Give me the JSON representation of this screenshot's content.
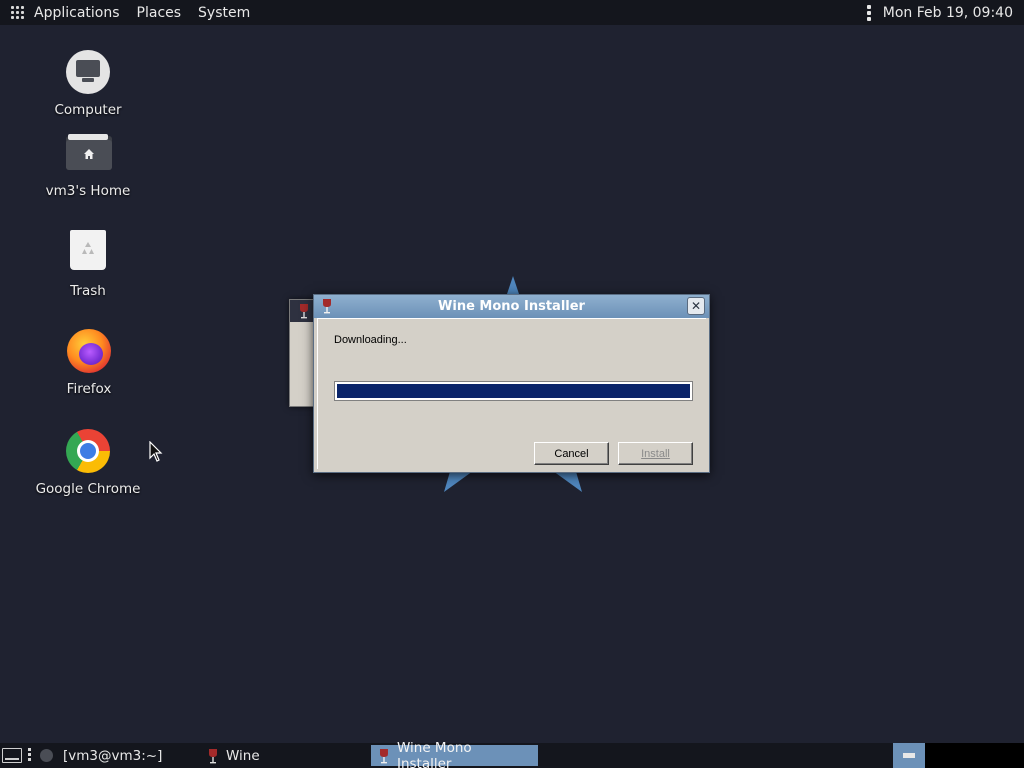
{
  "top_panel": {
    "applications": "Applications",
    "places": "Places",
    "system": "System",
    "clock": "Mon Feb 19, 09:40"
  },
  "desktop": {
    "computer": "Computer",
    "home": "vm3's Home",
    "trash": "Trash",
    "firefox": "Firefox",
    "chrome": "Google Chrome"
  },
  "dialog": {
    "title": "Wine Mono Installer",
    "status": "Downloading...",
    "progress": 1.0,
    "cancel": "Cancel",
    "install": "Install"
  },
  "taskbar": {
    "terminal": "[vm3@vm3:~]",
    "wine": "Wine",
    "installer": "Wine Mono Installer"
  },
  "colors": {
    "desktop_bg": "#1f2230",
    "panel_bg": "#14161d",
    "accent": "#6c91b8",
    "progress_fill": "#0a246a",
    "dialog_face": "#d4d0c8"
  }
}
